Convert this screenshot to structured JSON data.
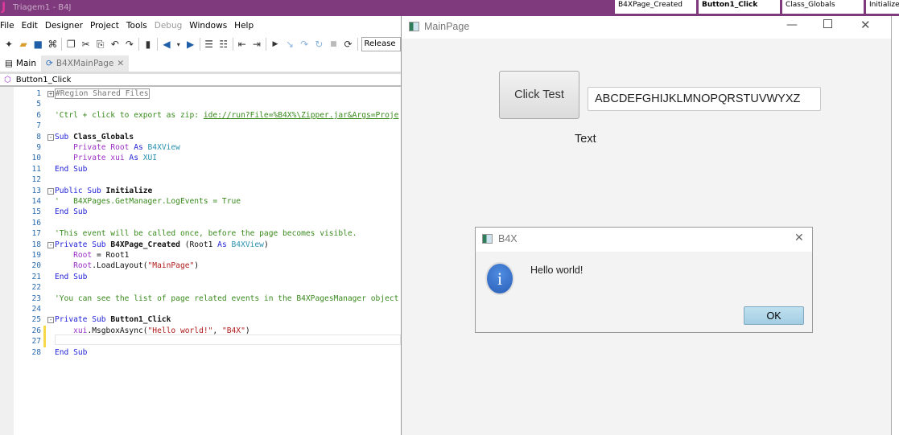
{
  "ide": {
    "title": "Triagem1 - B4J",
    "logo": "J",
    "pinned_tabs": [
      {
        "name": "B4XPage_Created",
        "sub": "B4XMainPage"
      },
      {
        "name": "Button1_Click",
        "sub": "B4XMainPage"
      },
      {
        "name": "Class_Globals",
        "sub": "B4XMainPage"
      },
      {
        "name": "Initialize",
        "sub": "B4XMain"
      }
    ],
    "menu": [
      "File",
      "Edit",
      "Designer",
      "Project",
      "Tools",
      "Debug",
      "Windows",
      "Help"
    ],
    "disabled_menu": "Debug",
    "build_config": "Release",
    "tabs": [
      {
        "label": "Main",
        "icon": "module-icon"
      },
      {
        "label": "B4XMainPage",
        "icon": "class-icon",
        "close": "✕"
      }
    ],
    "current_sub": "Button1_Click",
    "code": [
      {
        "n": "1",
        "fold": "+",
        "seg": [
          {
            "t": "#Region Shared Files",
            "c": "rg"
          }
        ]
      },
      {
        "n": "5",
        "seg": []
      },
      {
        "n": "6",
        "seg": [
          {
            "t": "'Ctrl + click to export as zip: ",
            "c": "cm"
          },
          {
            "t": "ide://run?File=%B4X%\\Zipper.jar&Args=Proje",
            "c": "lk"
          }
        ]
      },
      {
        "n": "7",
        "seg": []
      },
      {
        "n": "8",
        "fold": "-",
        "seg": [
          {
            "t": "Sub ",
            "c": "kw"
          },
          {
            "t": "Class_Globals",
            "c": "bd"
          }
        ]
      },
      {
        "n": "9",
        "seg": [
          {
            "t": "    Private ",
            "c": "pr"
          },
          {
            "t": "Root ",
            "c": "pr"
          },
          {
            "t": "As ",
            "c": "kw"
          },
          {
            "t": "B4XView",
            "c": "ty"
          }
        ]
      },
      {
        "n": "10",
        "seg": [
          {
            "t": "    Private ",
            "c": "pr"
          },
          {
            "t": "xui ",
            "c": "pr"
          },
          {
            "t": "As ",
            "c": "kw"
          },
          {
            "t": "XUI",
            "c": "ty"
          }
        ]
      },
      {
        "n": "11",
        "seg": [
          {
            "t": "End Sub",
            "c": "kw"
          }
        ]
      },
      {
        "n": "12",
        "seg": []
      },
      {
        "n": "13",
        "fold": "-",
        "seg": [
          {
            "t": "Public Sub ",
            "c": "kw"
          },
          {
            "t": "Initialize",
            "c": "bd"
          }
        ]
      },
      {
        "n": "14",
        "seg": [
          {
            "t": "'   B4XPages.GetManager.LogEvents = True",
            "c": "cm"
          }
        ]
      },
      {
        "n": "15",
        "seg": [
          {
            "t": "End Sub",
            "c": "kw"
          }
        ]
      },
      {
        "n": "16",
        "seg": []
      },
      {
        "n": "17",
        "seg": [
          {
            "t": "'This event will be called once, before the page becomes visible.",
            "c": "cm"
          }
        ]
      },
      {
        "n": "18",
        "fold": "-",
        "seg": [
          {
            "t": "Private Sub ",
            "c": "kw"
          },
          {
            "t": "B4XPage_Created ",
            "c": "bd"
          },
          {
            "t": "(Root1 ",
            "c": "id"
          },
          {
            "t": "As ",
            "c": "kw"
          },
          {
            "t": "B4XView",
            "c": "ty"
          },
          {
            "t": ")",
            "c": "id"
          }
        ]
      },
      {
        "n": "19",
        "seg": [
          {
            "t": "    Root ",
            "c": "pr"
          },
          {
            "t": "= Root1",
            "c": "id"
          }
        ]
      },
      {
        "n": "20",
        "seg": [
          {
            "t": "    Root",
            "c": "pr"
          },
          {
            "t": ".LoadLayout(",
            "c": "id"
          },
          {
            "t": "\"MainPage\"",
            "c": "st"
          },
          {
            "t": ")",
            "c": "id"
          }
        ]
      },
      {
        "n": "21",
        "seg": [
          {
            "t": "End Sub",
            "c": "kw"
          }
        ]
      },
      {
        "n": "22",
        "seg": []
      },
      {
        "n": "23",
        "seg": [
          {
            "t": "'You can see the list of page related events in the B4XPagesManager object",
            "c": "cm"
          }
        ]
      },
      {
        "n": "24",
        "seg": []
      },
      {
        "n": "25",
        "fold": "-",
        "seg": [
          {
            "t": "Private Sub ",
            "c": "kw"
          },
          {
            "t": "Button1_Click",
            "c": "bd"
          }
        ]
      },
      {
        "n": "26",
        "mark": true,
        "seg": [
          {
            "t": "    xui",
            "c": "pr"
          },
          {
            "t": ".MsgboxAsync(",
            "c": "id"
          },
          {
            "t": "\"Hello world!\"",
            "c": "st"
          },
          {
            "t": ", ",
            "c": "id"
          },
          {
            "t": "\"B4X\"",
            "c": "st"
          },
          {
            "t": ")",
            "c": "id"
          }
        ]
      },
      {
        "n": "27",
        "mark": true,
        "seg": []
      },
      {
        "n": "28",
        "seg": [
          {
            "t": "End Sub",
            "c": "kw"
          }
        ]
      }
    ]
  },
  "mainpage": {
    "title": "MainPage",
    "button_label": "Click Test",
    "textfield_value": "ABCDEFGHIJKLMNOPQRSTUVWYXZ",
    "label_text": "Text"
  },
  "dialog": {
    "title": "B4X",
    "message": "Hello world!",
    "ok_label": "OK",
    "icon": "info-icon"
  }
}
